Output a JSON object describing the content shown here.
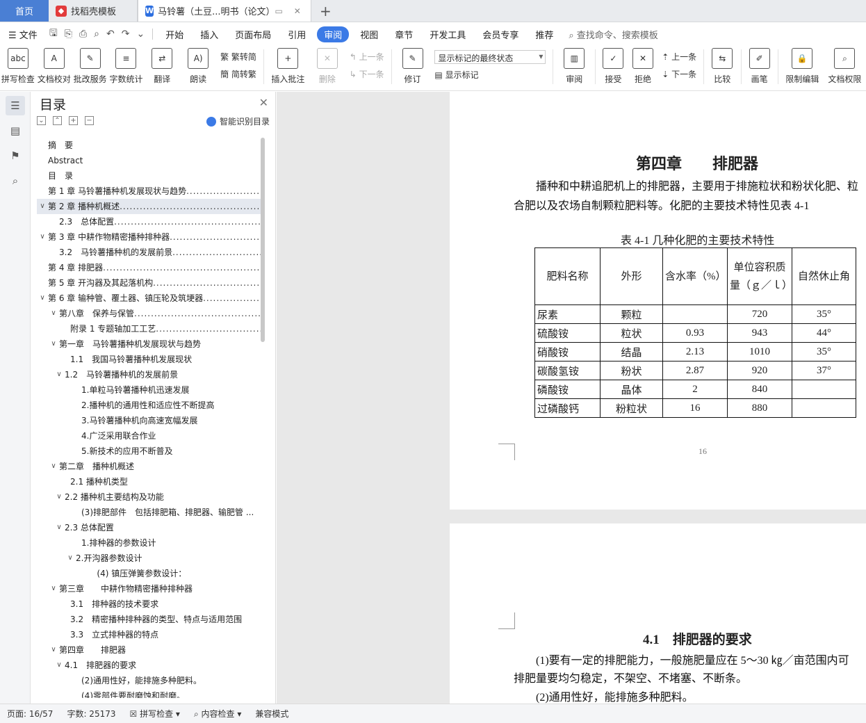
{
  "tabs": {
    "home": "首页",
    "template": "找稻壳模板",
    "doc": "马铃薯（土豆...明书（论文）",
    "plus": "+"
  },
  "menu": {
    "file": "文件",
    "items": [
      "开始",
      "插入",
      "页面布局",
      "引用",
      "审阅",
      "视图",
      "章节",
      "开发工具",
      "会员专享",
      "推荐"
    ],
    "search": "查找命令、搜索模板"
  },
  "ribbon": {
    "spellcheck": "拼写检查",
    "proofread": "文档校对",
    "batch": "批改服务",
    "wordcount": "字数统计",
    "translate": "翻译",
    "read": "朗读",
    "trad": "繁转简",
    "simp": "简转繁",
    "insert_comment": "插入批注",
    "delete": "删除",
    "prev": "上一条",
    "next": "下一条",
    "revise": "修订",
    "markup_state": "显示标记的最终状态",
    "show_markup": "显示标记",
    "review": "审阅",
    "accept": "接受",
    "reject": "拒绝",
    "prev2": "上一条",
    "next2": "下一条",
    "compare": "比较",
    "pen": "画笔",
    "restrict": "限制编辑",
    "perm": "文档权限"
  },
  "toc": {
    "title": "目录",
    "smart": "智能识别目录",
    "items": [
      {
        "text": "摘　要",
        "indent": 0,
        "arrow": "",
        "dots": false
      },
      {
        "text": "Abstract",
        "indent": 0,
        "arrow": "",
        "dots": false
      },
      {
        "text": "目　录",
        "indent": 0,
        "arrow": "",
        "dots": false
      },
      {
        "text": "第 1 章  马铃薯播种机发展现状与趋势 ",
        "indent": 0,
        "arrow": "",
        "dots": true
      },
      {
        "text": "第 2 章  播种机概述 ",
        "indent": 0,
        "arrow": "∨",
        "dots": true,
        "sel": true
      },
      {
        "text": "2.3　总体配置 ",
        "indent": 1,
        "arrow": "",
        "dots": true
      },
      {
        "text": "第 3 章  中耕作物精密播种排种器 ",
        "indent": 0,
        "arrow": "∨",
        "dots": true
      },
      {
        "text": "3.2　马铃薯播种机的发展前景 ",
        "indent": 1,
        "arrow": "",
        "dots": true
      },
      {
        "text": "第 4 章  排肥器",
        "indent": 0,
        "arrow": "",
        "dots": true
      },
      {
        "text": "第 5 章  开沟器及其起落机构",
        "indent": 0,
        "arrow": "",
        "dots": true
      },
      {
        "text": "第 6 章  输种管、覆土器、镇压轮及筑埂器",
        "indent": 0,
        "arrow": "∨",
        "dots": true
      },
      {
        "text": "第八章　保养与保管 ",
        "indent": 1,
        "arrow": "∨",
        "dots": true
      },
      {
        "text": "附录 1 专题轴加工工艺 ",
        "indent": 2,
        "arrow": "",
        "dots": true
      },
      {
        "text": "第一章　马铃薯播种机发展现状与趋势",
        "indent": 1,
        "arrow": "∨",
        "dots": false
      },
      {
        "text": "1.1　我国马铃薯播种机发展现状",
        "indent": 2,
        "arrow": "",
        "dots": false
      },
      {
        "text": "1.2　马铃薯播种机的发展前景",
        "indent": 1.5,
        "arrow": "∨",
        "dots": false
      },
      {
        "text": "1.单粒马铃薯播种机迅速发展",
        "indent": 3,
        "arrow": "",
        "dots": false
      },
      {
        "text": "2.播种机的通用性和适应性不断提高",
        "indent": 3,
        "arrow": "",
        "dots": false
      },
      {
        "text": "3.马铃薯播种机向高速宽幅发展",
        "indent": 3,
        "arrow": "",
        "dots": false
      },
      {
        "text": "4.广泛采用联合作业",
        "indent": 3,
        "arrow": "",
        "dots": false
      },
      {
        "text": "5.新技术的应用不断普及",
        "indent": 3,
        "arrow": "",
        "dots": false
      },
      {
        "text": "第二章　播种机概述",
        "indent": 1,
        "arrow": "∨",
        "dots": false
      },
      {
        "text": "2.1  播种机类型",
        "indent": 2,
        "arrow": "",
        "dots": false
      },
      {
        "text": "2.2  播种机主要结构及功能",
        "indent": 1.5,
        "arrow": "∨",
        "dots": false
      },
      {
        "text": "(3)排肥部件　包括排肥箱、排肥器、输肥管 ...",
        "indent": 3,
        "arrow": "",
        "dots": false
      },
      {
        "text": "2.3  总体配置",
        "indent": 1.5,
        "arrow": "∨",
        "dots": false
      },
      {
        "text": "1.排种器的参数设计",
        "indent": 3,
        "arrow": "",
        "dots": false
      },
      {
        "text": "2.开沟器参数设计",
        "indent": 2.5,
        "arrow": "∨",
        "dots": false
      },
      {
        "text": "(4)  镇压弹簧参数设计：",
        "indent": 4.4,
        "arrow": "",
        "dots": false
      },
      {
        "text": "第三章　　中耕作物精密播种排种器",
        "indent": 1,
        "arrow": "∨",
        "dots": false
      },
      {
        "text": "3.1　排种器的技术要求",
        "indent": 2,
        "arrow": "",
        "dots": false
      },
      {
        "text": "3.2　精密播种排种器的类型、特点与适用范围",
        "indent": 2,
        "arrow": "",
        "dots": false
      },
      {
        "text": "3.3　立式排种器的特点",
        "indent": 2,
        "arrow": "",
        "dots": false
      },
      {
        "text": "第四章　　排肥器",
        "indent": 1,
        "arrow": "∨",
        "dots": false
      },
      {
        "text": "4.1　排肥器的要求",
        "indent": 1.5,
        "arrow": "∨",
        "dots": false
      },
      {
        "text": "(2)通用性好，能排施多种肥料。",
        "indent": 3,
        "arrow": "",
        "dots": false
      },
      {
        "text": "(4)零部件要耐磨蚀和耐磨。",
        "indent": 3,
        "arrow": "",
        "dots": false
      }
    ]
  },
  "doc": {
    "chapter_title": "第四章　　排肥器",
    "para1_line1": "播种和中耕追肥机上的排肥器，主要用于排施粒状和粉状化肥、粒",
    "para1_line2": "合肥以及农场自制颗粒肥料等。化肥的主要技术特性见表 4-1",
    "table_caption": "表 4-1  几种化肥的主要技术特性",
    "table": {
      "headers": [
        "肥料名称",
        "外形",
        "含水率（%）",
        "单位容积质量（ｇ／ｌ）",
        "自然休止角"
      ],
      "rows": [
        [
          "尿素",
          "颗粒",
          "",
          "720",
          "35°"
        ],
        [
          "硫酸铵",
          "粒状",
          "0.93",
          "943",
          "44°"
        ],
        [
          "硝酸铵",
          "结晶",
          "2.13",
          "1010",
          "35°"
        ],
        [
          "碳酸氢铵",
          "粉状",
          "2.87",
          "920",
          "37°"
        ],
        [
          "磷酸铵",
          "晶体",
          "2",
          "840",
          ""
        ],
        [
          "过磷酸钙",
          "粉粒状",
          "16",
          "880",
          ""
        ]
      ]
    },
    "page_number": "16",
    "section_title": "4.1　排肥器的要求",
    "para2_line1": "(1)要有一定的排肥能力，一般施肥量应在 5～30 ㎏／亩范围内可",
    "para2_line2": "排肥量要均匀稳定，不架空、不堵塞、不断条。",
    "para3": "(2)通用性好，能排施多种肥料。"
  },
  "status": {
    "page": "页面: 16/57",
    "words": "字数: 25173",
    "spell": "拼写检查",
    "content": "内容检查",
    "compat": "兼容模式"
  }
}
